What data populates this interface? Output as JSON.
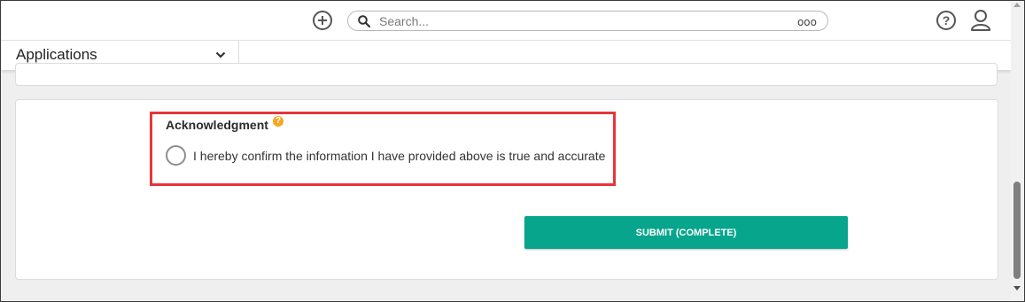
{
  "header": {
    "search": {
      "placeholder": "Search...",
      "value": ""
    },
    "icons": {
      "add": "plus-circle-icon",
      "search": "search-icon",
      "more": "more-options-icon",
      "help": "help-icon",
      "user": "user-icon"
    },
    "more_glyph": "ooo",
    "help_glyph": "?"
  },
  "nav": {
    "app_selector_label": "Applications",
    "chevron": "chevron-down-icon"
  },
  "form": {
    "acknowledgment": {
      "title": "Acknowledgment",
      "info_glyph": "?",
      "option_label": "I hereby confirm the information I have provided above is true and accurate",
      "selected": false
    },
    "submit_label": "SUBMIT (COMPLETE)"
  },
  "colors": {
    "submit_bg": "#08a58d",
    "highlight_border": "#e8353b",
    "info_icon": "#f5a623"
  }
}
